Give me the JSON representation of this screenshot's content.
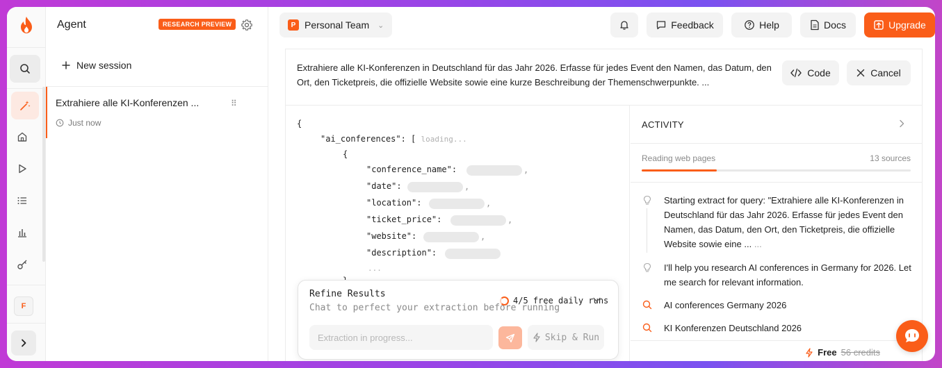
{
  "sessions_panel": {
    "title": "Agent",
    "badge": "RESEARCH PREVIEW",
    "new_session_label": "New session",
    "items": [
      {
        "title": "Extrahiere alle KI-Konferenzen ...",
        "time": "Just now"
      }
    ]
  },
  "rail": {
    "avatar_letter": "F"
  },
  "topbar": {
    "team_letter": "P",
    "team_name": "Personal Team",
    "feedback_label": "Feedback",
    "help_label": "Help",
    "docs_label": "Docs",
    "upgrade_label": "Upgrade"
  },
  "main": {
    "query": "Extrahiere alle KI-Konferenzen in Deutschland für das Jahr 2026. Erfasse für jedes Event den Namen, das Datum, den Ort, den Ticketpreis, die offizielle Website sowie eine kurze Beschreibung der Themenschwerpunkte. ...",
    "code_label": "Code",
    "cancel_label": "Cancel"
  },
  "code": {
    "open_brace": "{",
    "root_key": "\"ai_conferences\": [",
    "loading": "loading...",
    "item_open": "{",
    "fields": [
      "\"conference_name\":",
      "\"date\":",
      "\"location\":",
      "\"ticket_price\":",
      "\"website\":",
      "\"description\":"
    ],
    "more": "...",
    "item_close": "},"
  },
  "refine": {
    "title": "Refine Results",
    "subtitle": "Chat to perfect your extraction before running",
    "runs": "4/5 free daily runs",
    "runs_used_fraction": 0.8,
    "input_placeholder": "Extraction in progress...",
    "skip_label": "Skip & Run"
  },
  "activity": {
    "title": "ACTIVITY",
    "status": "Reading web pages",
    "sources": "13 sources",
    "progress": 0.28,
    "log": [
      {
        "icon": "lightbulb-icon",
        "text": "Starting extract for query: \"Extrahiere alle KI-Konferenzen in Deutschland für das Jahr 2026. Erfasse für jedes Event den Namen, das Datum, den Ort, den Ticketpreis, die offizielle Website sowie eine ...",
        "suffix": "..."
      },
      {
        "icon": "lightbulb-icon",
        "text": "I'll help you research AI conferences in Germany for 2026. Let me search for relevant information."
      },
      {
        "icon": "search-icon",
        "text": "AI conferences Germany 2026"
      },
      {
        "icon": "search-icon",
        "text": "KI Konferenzen Deutschland 2026"
      }
    ],
    "credits_free": "Free",
    "credits_amount": "56 credits"
  },
  "colors": {
    "accent": "#fa5d19"
  }
}
